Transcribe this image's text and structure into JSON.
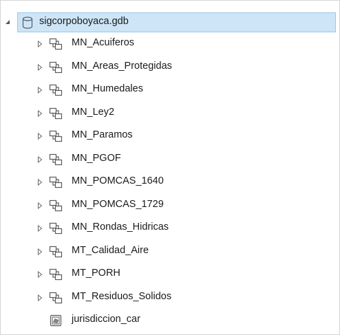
{
  "tree": {
    "root": {
      "label": "sigcorpoboyaca.gdb",
      "toggle_icon": "expanded-triangle-icon",
      "icon": "database-icon"
    },
    "items": [
      {
        "label": "MN_Acuiferos",
        "icon": "feature-dataset-icon",
        "toggle_icon": "collapsed-triangle-icon"
      },
      {
        "label": "MN_Areas_Protegidas",
        "icon": "feature-dataset-icon",
        "toggle_icon": "collapsed-triangle-icon"
      },
      {
        "label": "MN_Humedales",
        "icon": "feature-dataset-icon",
        "toggle_icon": "collapsed-triangle-icon"
      },
      {
        "label": "MN_Ley2",
        "icon": "feature-dataset-icon",
        "toggle_icon": "collapsed-triangle-icon"
      },
      {
        "label": "MN_Paramos",
        "icon": "feature-dataset-icon",
        "toggle_icon": "collapsed-triangle-icon"
      },
      {
        "label": "MN_PGOF",
        "icon": "feature-dataset-icon",
        "toggle_icon": "collapsed-triangle-icon"
      },
      {
        "label": "MN_POMCAS_1640",
        "icon": "feature-dataset-icon",
        "toggle_icon": "collapsed-triangle-icon"
      },
      {
        "label": "MN_POMCAS_1729",
        "icon": "feature-dataset-icon",
        "toggle_icon": "collapsed-triangle-icon"
      },
      {
        "label": "MN_Rondas_Hidricas",
        "icon": "feature-dataset-icon",
        "toggle_icon": "collapsed-triangle-icon"
      },
      {
        "label": "MT_Calidad_Aire",
        "icon": "feature-dataset-icon",
        "toggle_icon": "collapsed-triangle-icon"
      },
      {
        "label": "MT_PORH",
        "icon": "feature-dataset-icon",
        "toggle_icon": "collapsed-triangle-icon"
      },
      {
        "label": "MT_Residuos_Solidos",
        "icon": "feature-dataset-icon",
        "toggle_icon": "collapsed-triangle-icon"
      },
      {
        "label": "jurisdiccion_car",
        "icon": "polygon-feature-class-icon",
        "toggle_icon": ""
      }
    ]
  },
  "colors": {
    "selection_fill": "#cde5f7",
    "selection_border": "#99c9ef",
    "icon_stroke": "#5a5a5a",
    "text": "#1a1a1a"
  }
}
